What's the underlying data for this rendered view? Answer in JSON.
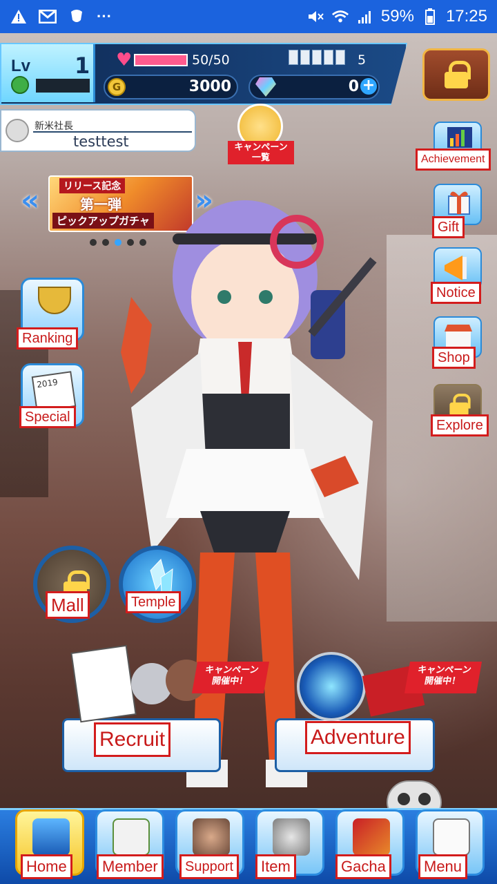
{
  "status_bar": {
    "notif_icons": [
      "warning-icon",
      "gmail-icon",
      "app-icon",
      "more-icon"
    ],
    "more": "···",
    "battery": "59%",
    "time": "17:25",
    "bar_color": "#1b63de"
  },
  "player": {
    "level_label": "Lv",
    "level": "1",
    "hp": "50/50",
    "cards": "5",
    "coins": "3000",
    "gems": "0",
    "gem_add": "+",
    "coin_symbol": "G",
    "title": "新米社長",
    "name": "testtest"
  },
  "campaign": {
    "label": "キャンペーン\n一覧"
  },
  "banner": {
    "line1": "リリース記念",
    "line2": "第一弾",
    "line3": "ピックアップガチャ",
    "prev": "«",
    "next": "»",
    "active_index": 2,
    "count": 5
  },
  "left_menu": {
    "ranking": "Ranking",
    "special": "Special",
    "calendar_year": "2019"
  },
  "right_menu": {
    "achievement": "Achievement",
    "gift": "Gift",
    "notice": "Notice",
    "shop": "Shop",
    "explore": "Explore"
  },
  "circle_buttons": {
    "mall": "Mall",
    "temple": "Temple"
  },
  "main_buttons": {
    "recruit": "Recruit",
    "recruit_tag": "キャンペーン\n開催中！",
    "adventure": "Adventure",
    "adventure_tag": "キャンペーン\n開催中！"
  },
  "bottom_nav": {
    "home": "Home",
    "member": "Member",
    "support": "Support",
    "item": "Item",
    "gacha": "Gacha",
    "menu": "Menu"
  },
  "colors": {
    "label_red": "#d31c1c",
    "accent_blue": "#2b8ce0",
    "home_yellow": "#f5c52a"
  }
}
